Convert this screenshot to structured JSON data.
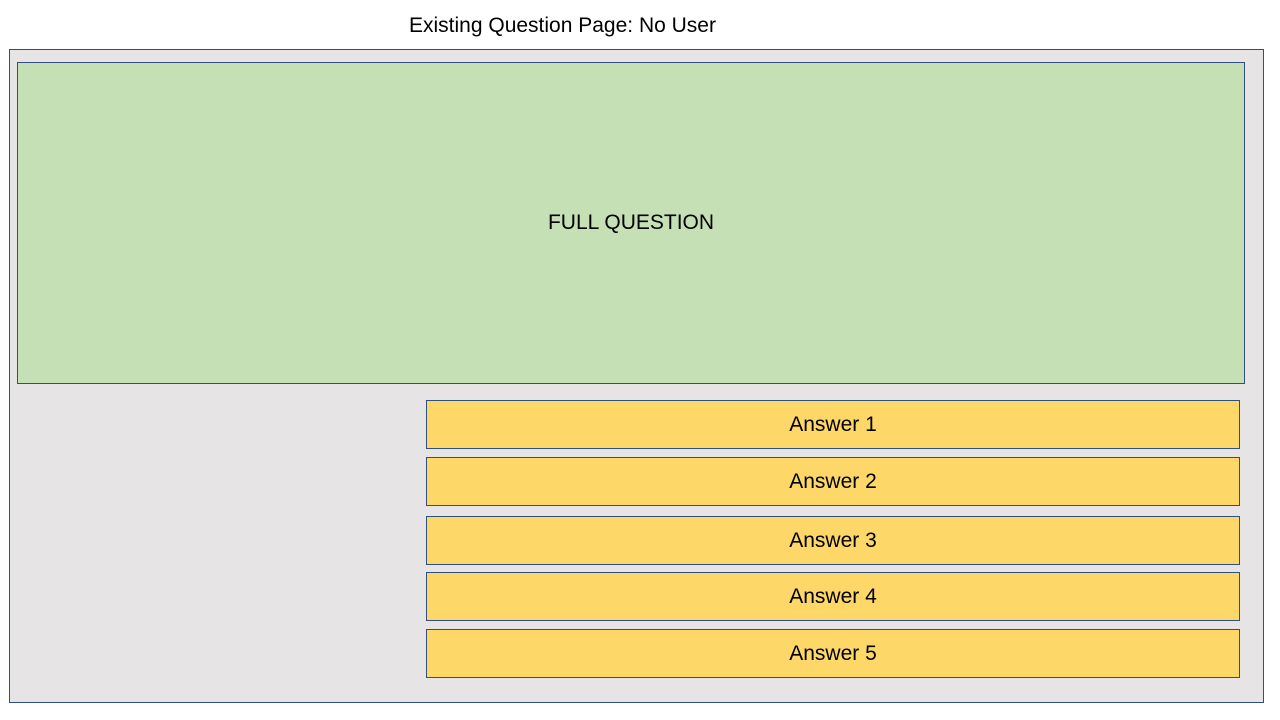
{
  "header": {
    "title": "Existing Question Page: No User"
  },
  "question": {
    "text": "FULL QUESTION"
  },
  "answers": [
    {
      "label": "Answer 1"
    },
    {
      "label": "Answer 2"
    },
    {
      "label": "Answer 3"
    },
    {
      "label": "Answer 4"
    },
    {
      "label": "Answer 5"
    }
  ],
  "colors": {
    "frame_background": "#e7e4e5",
    "question_background": "#c5e0b4",
    "answer_background": "#fdd868",
    "border": "#2f4f7f"
  }
}
